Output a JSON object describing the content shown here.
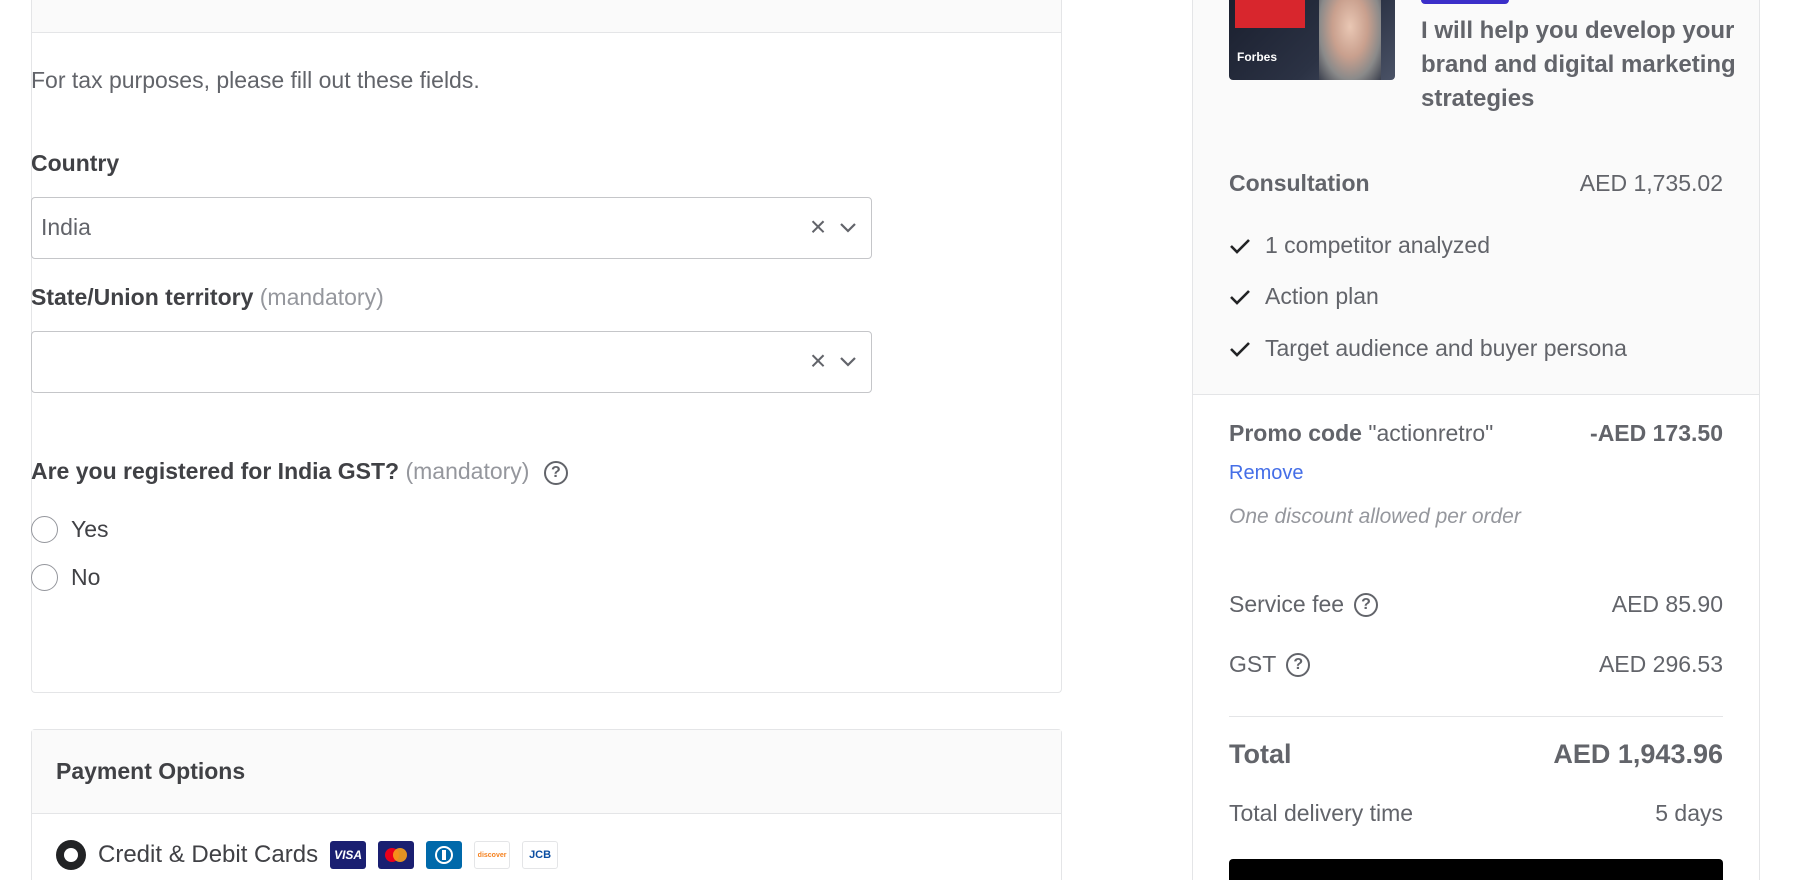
{
  "billing": {
    "tax_note": "For tax purposes, please fill out these fields.",
    "country_label": "Country",
    "country_value": "India",
    "state_label": "State/Union territory",
    "state_mandatory": "(mandatory)",
    "gst_question": "Are you registered for India GST?",
    "gst_mandatory": "(mandatory)",
    "help_glyph": "?",
    "clear_glyph": "×",
    "options": {
      "yes": "Yes",
      "no": "No"
    }
  },
  "payment": {
    "title": "Payment Options",
    "method_label": "Credit & Debit Cards",
    "cards": [
      {
        "name": "VISA",
        "bg": "#1a1f71",
        "fg": "#ffffff"
      },
      {
        "name": "mc",
        "bg": "#1a1f71",
        "fg": "#ffffff"
      },
      {
        "name": "diners",
        "bg": "#0069aa",
        "fg": "#ffffff"
      },
      {
        "name": "discover",
        "bg": "#ffffff",
        "fg": "#f58220"
      },
      {
        "name": "JCB",
        "bg": "#ffffff",
        "fg": "#0b4ea2"
      }
    ]
  },
  "summary": {
    "gig_title": "I will help you develop your brand and digital marketing strategies",
    "package_name": "Consultation",
    "package_price": "AED 1,735.02",
    "features": [
      "1 competitor analyzed",
      "Action plan",
      "Target audience and buyer persona"
    ],
    "promo_label": "Promo code",
    "promo_code": "\"actionretro\"",
    "promo_amount": "-AED 173.50",
    "remove_label": "Remove",
    "discount_note": "One discount allowed per order",
    "service_fee_label": "Service fee",
    "service_fee_value": "AED 85.90",
    "gst_label": "GST",
    "gst_value": "AED 296.53",
    "total_label": "Total",
    "total_value": "AED 1,943.96",
    "delivery_label": "Total delivery time",
    "delivery_value": "5 days"
  },
  "colors": {
    "link": "#446ee7",
    "accent": "#3b2fc9",
    "text": "#62646a"
  }
}
